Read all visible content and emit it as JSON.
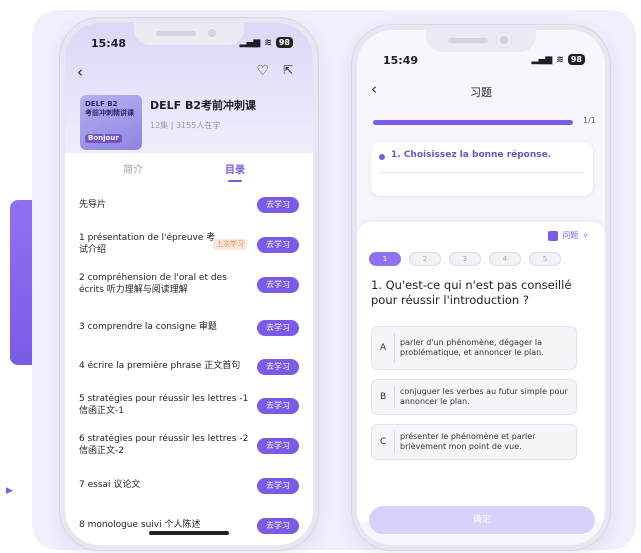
{
  "left_phone": {
    "time": "15:48",
    "battery": "98",
    "cover": {
      "line1": "DELF B2",
      "line2": "考前冲刺精讲课",
      "tag": "Bonjour"
    },
    "course_title": "DELF B2考前冲刺课",
    "course_meta": "12集 | 3155人在学",
    "tabs": [
      "简介",
      "目录"
    ],
    "study_label": "去学习",
    "last_study_badge": "上次学习",
    "lessons": [
      "先导片",
      "1 présentation de l'épreuve 考试介绍",
      "2 compréhension de l'oral et des écrits 听力理解与阅读理解",
      "3 comprendre la consigne 审题",
      "4 écrire la première phrase 正文首句",
      "5 stratégies pour réussir les lettres -1 信函正文-1",
      "6 stratégies pour réussir les lettres -2 信函正文-2",
      "7 essai 议论文",
      "8 monologue suivi 个人陈述"
    ]
  },
  "right_phone": {
    "time": "15:49",
    "battery": "98",
    "title": "习题",
    "progress_label": "1/1",
    "progress": 1.0,
    "instruction": "1. Choisissez la bonne réponse.",
    "tool_label": "问题",
    "question_numbers": [
      "1",
      "2",
      "3",
      "4",
      "5"
    ],
    "question": "1. Qu'est-ce qui n'est pas conseillé pour réussir l'introduction ?",
    "options": [
      {
        "key": "A",
        "text": "parler d'un phénomène, dégager la problématique, et annoncer le plan."
      },
      {
        "key": "B",
        "text": "conjuguer les verbes au futur simple pour annoncer le plan."
      },
      {
        "key": "C",
        "text": "présenter le phénomène et parler brièvement mon point de vue."
      }
    ],
    "confirm_label": "确定"
  },
  "colors": {
    "accent": "#7a5be8",
    "panel": "#f1effd",
    "badge": "#e38a55"
  }
}
